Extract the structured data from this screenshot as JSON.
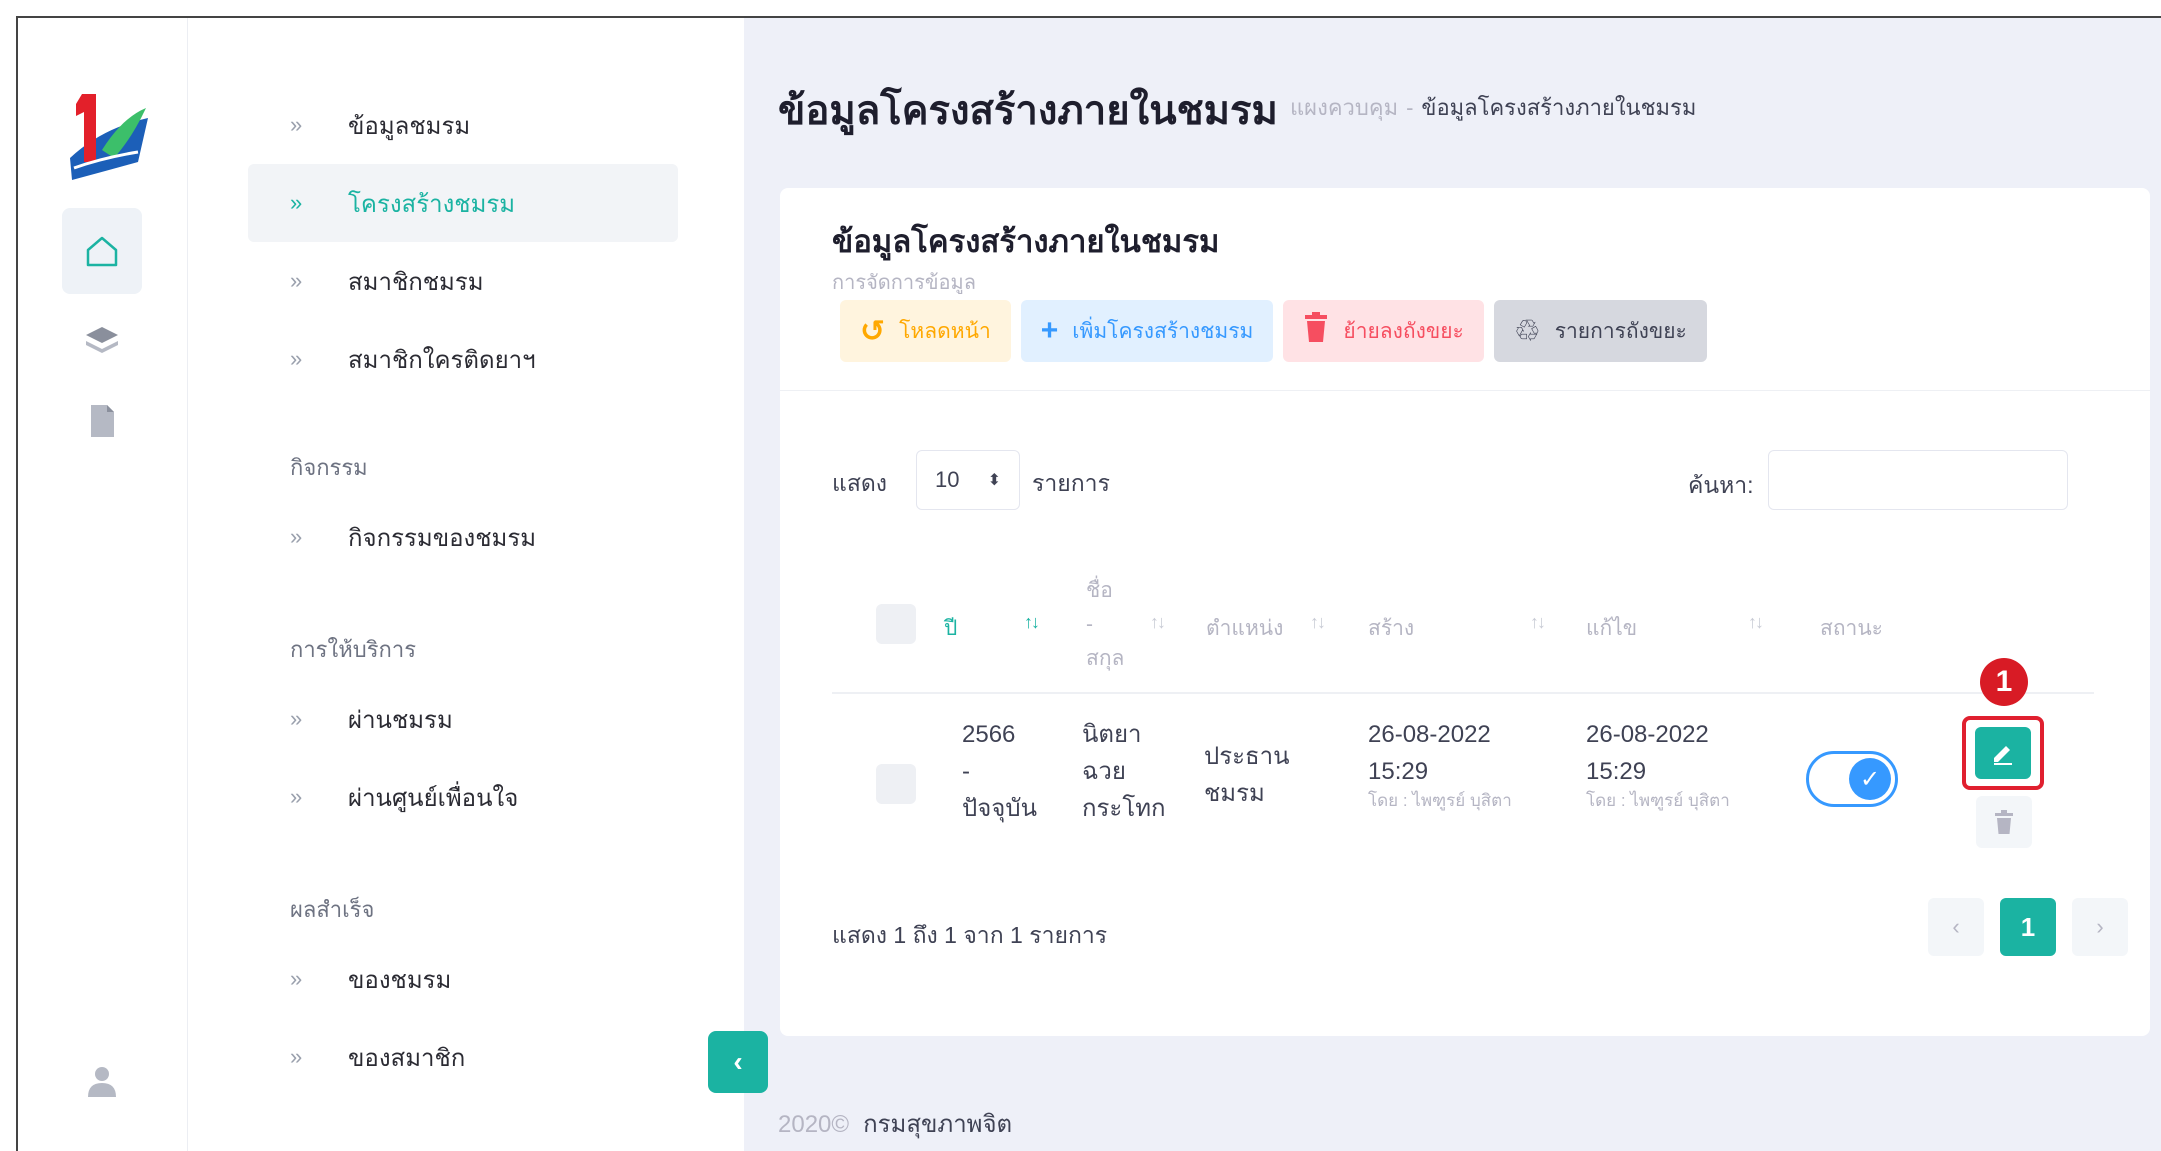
{
  "menu": {
    "items_top": [
      {
        "label": "ข้อมูลชมรม",
        "active": false
      },
      {
        "label": "โครงสร้างชมรม",
        "active": true
      },
      {
        "label": "สมาชิกชมรม",
        "active": false
      },
      {
        "label": "สมาชิกใครติดยาฯ",
        "active": false
      }
    ],
    "section_activity": "กิจกรรม",
    "item_activity": "กิจกรรมของชมรม",
    "section_service": "การให้บริการ",
    "item_service_1": "ผ่านชมรม",
    "item_service_2": "ผ่านศูนย์เพื่อนใจ",
    "section_result": "ผลสำเร็จ",
    "item_result_1": "ของชมรม",
    "item_result_2": "ของสมาชิก",
    "chevron": "»"
  },
  "header": {
    "title": "ข้อมูลโครงสร้างภายในชมรม",
    "breadcrumb_root": "แผงควบคุม",
    "breadcrumb_sep": "-",
    "breadcrumb_current": "ข้อมูลโครงสร้างภายในชมรม"
  },
  "card": {
    "title": "ข้อมูลโครงสร้างภายในชมรม",
    "subtitle": "การจัดการข้อมูล",
    "buttons": {
      "reload": "โหลดหน้า",
      "add": "เพิ่มโครงสร้างชมรม",
      "move_trash": "ย้ายลงถังขยะ",
      "trash_list": "รายการถังขยะ"
    }
  },
  "table_controls": {
    "show_label": "แสดง",
    "page_length": "10",
    "length_unit": "รายการ",
    "search_label": "ค้นหา:",
    "search_value": ""
  },
  "table": {
    "headers": {
      "year": "ปี",
      "name_1": "ชื่อ",
      "name_2": "-",
      "name_3": "สกุล",
      "position": "ตำแหน่ง",
      "created": "สร้าง",
      "updated": "แก้ไข",
      "status": "สถานะ"
    },
    "row": {
      "year_1": "2566",
      "year_2": "-",
      "year_3": "ปัจจุบัน",
      "name_1": "นิตยา",
      "name_2": "ฉวย",
      "name_3": "กระโทก",
      "position_1": "ประธาน",
      "position_2": "ชมรม",
      "created_date": "26-08-2022",
      "created_time": "15:29",
      "created_by": "โดย : ไพฑูรย์ บุสิตา",
      "updated_date": "26-08-2022",
      "updated_time": "15:29",
      "updated_by": "โดย : ไพฑูรย์ บุสิตา",
      "status_on": true
    },
    "annotation_marker": "1"
  },
  "pagination": {
    "info": "แสดง 1 ถึง 1 จาก 1 รายการ",
    "prev": "‹",
    "current": "1",
    "next": "›"
  },
  "footer": {
    "year": "2020©",
    "org": "กรมสุขภาพจิต"
  },
  "colors": {
    "accent": "#1bb3a2",
    "primary": "#3699ff",
    "danger": "#f64e60",
    "warning": "#ffa800",
    "annotation": "#e0202f"
  }
}
